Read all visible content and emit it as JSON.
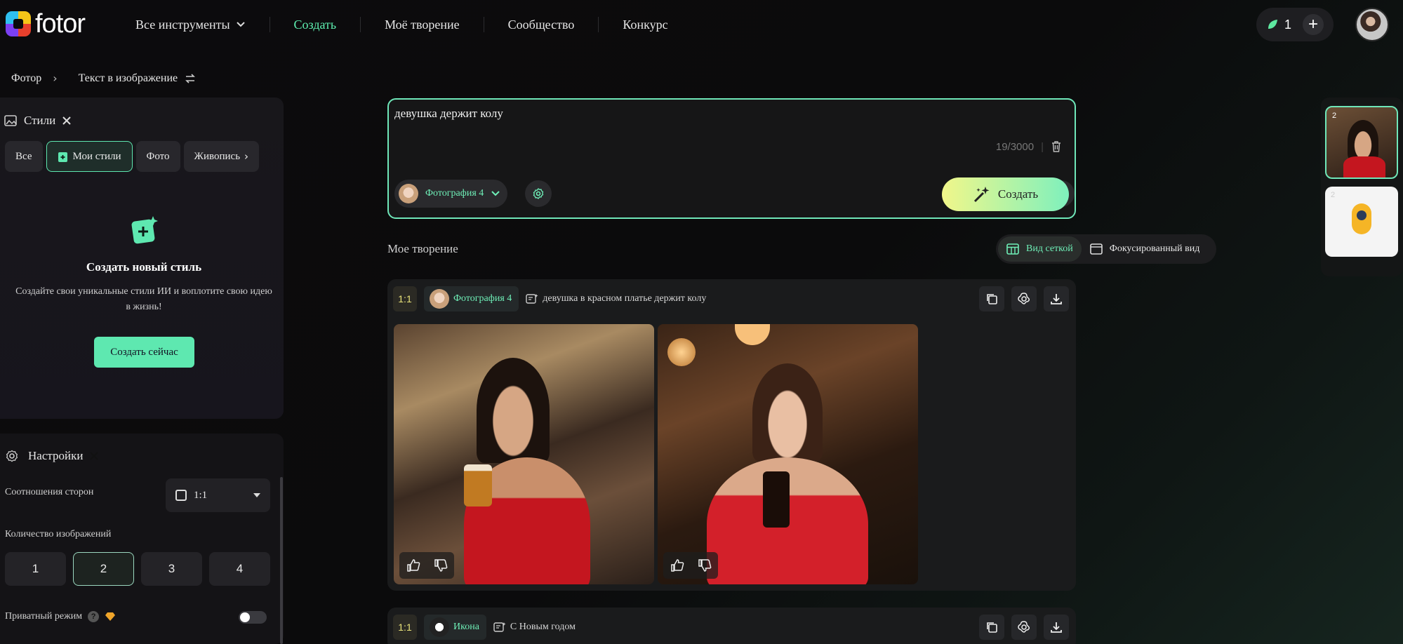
{
  "nav": {
    "logo": "fotor",
    "all_tools": "Все инструменты",
    "create": "Создать",
    "my_creations": "Моё творение",
    "community": "Сообщество",
    "contest": "Конкурс",
    "credits": "1"
  },
  "breadcrumb": {
    "root": "Фотор",
    "current": "Текст в изображение"
  },
  "styles": {
    "title": "Стили",
    "chips": [
      "Все",
      "Мои стили",
      "Фото",
      "Живопись"
    ],
    "new_title": "Создать новый стиль",
    "new_desc": "Создайте свои уникальные стили ИИ и воплотите свою идею в жизнь!",
    "create_now": "Создать сейчас"
  },
  "settings": {
    "title": "Настройки",
    "aspect_label": "Соотношения сторон",
    "aspect_value": "1:1",
    "count_label": "Количество изображений",
    "counts": [
      "1",
      "2",
      "3",
      "4"
    ],
    "selected_count": "2",
    "private_label": "Приватный режим",
    "private_on": false
  },
  "prompt": {
    "text": "девушка держит колу",
    "counter": "19/3000",
    "model": "Фотография 4",
    "create": "Создать"
  },
  "creations": {
    "title": "Мое творение",
    "grid_view": "Вид сеткой",
    "focus_view": "Фокусированный вид",
    "cards": [
      {
        "ratio": "1:1",
        "model": "Фотография 4",
        "prompt": "девушка в красном платье держит колу"
      },
      {
        "ratio": "1:1",
        "model": "Икона",
        "prompt": "С Новым годом"
      }
    ]
  },
  "thumbs": {
    "count1": "2",
    "count2": "2"
  },
  "colors": {
    "accent": "#5ef0b1",
    "badge": "#e9e37a"
  }
}
